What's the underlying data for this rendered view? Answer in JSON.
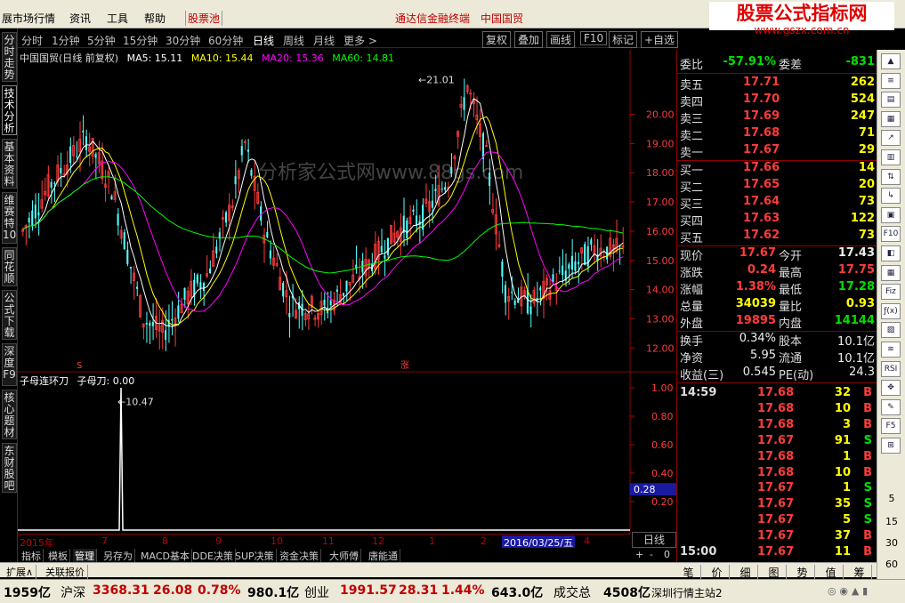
{
  "menu": {
    "items": [
      "展市场行情",
      "资讯",
      "工具",
      "帮助",
      "股票池"
    ],
    "center_link": "通达信金融终端",
    "stock_title": "中国国贸"
  },
  "logo": {
    "title": "股票公式指标网",
    "url": "www.gszx.com.cn"
  },
  "left_tabs": [
    "分时走势",
    "技术分析",
    "基本资料",
    "维赛特10",
    "同花顺",
    "公式下载",
    "深度F9",
    "核心题材",
    "东财股吧"
  ],
  "period_bar": {
    "periods": [
      "分时",
      "1分钟",
      "5分钟",
      "15分钟",
      "30分钟",
      "60分钟",
      "日线",
      "周线",
      "月线",
      "更多 >"
    ],
    "selected": "日线",
    "buttons": [
      "复权",
      "叠加",
      "画线",
      "F10",
      "标记",
      "+自选"
    ]
  },
  "ma_legend": {
    "title": "中国国贸(日线 前复权)",
    "ma5": "MA5: 15.11",
    "ma10": "MA10: 15.44",
    "ma20": "MA20: 15.36",
    "ma60": "MA60: 14.81"
  },
  "chart_data": {
    "type": "candlestick",
    "price_axis": {
      "ticks": [
        "20.00",
        "19.00",
        "18.00",
        "17.00",
        "16.00",
        "15.00",
        "14.00",
        "13.00",
        "12.00"
      ],
      "range": [
        11.4,
        21.6
      ]
    },
    "annotations": {
      "high": "21.01",
      "low": "10.47"
    },
    "markers": {
      "s": "S",
      "up": "涨"
    },
    "watermark": "分析家公式网www.88gs.com",
    "indicator": {
      "name": "子母连环刀",
      "label": "子母刀: 0.00",
      "ticks": [
        "1.00",
        "0.80",
        "0.60",
        "0.40",
        "0.20"
      ],
      "current": "0.28",
      "spike_value": 1.0
    },
    "months": [
      "2015年",
      "7",
      "8",
      "9",
      "10",
      "11",
      "12",
      "1",
      "2",
      "2016/03/25/五",
      "4"
    ]
  },
  "day_line": "日线",
  "zoom": [
    "+",
    "-",
    "0"
  ],
  "bottom_tabs": [
    "指标",
    "模板",
    "管理",
    "另存为",
    "MACD基本",
    "DDE决策",
    "SUP决策",
    "资金决策",
    "大师傅",
    "唐能通"
  ],
  "ext_tabs": [
    "扩展∧",
    "关联报价"
  ],
  "quote": {
    "weibi": {
      "label": "委比",
      "value": "-57.91%",
      "label2": "委差",
      "value2": "-831"
    },
    "sell": [
      {
        "label": "卖五",
        "price": "17.71",
        "vol": "262"
      },
      {
        "label": "卖四",
        "price": "17.70",
        "vol": "524"
      },
      {
        "label": "卖三",
        "price": "17.69",
        "vol": "247"
      },
      {
        "label": "卖二",
        "price": "17.68",
        "vol": "71"
      },
      {
        "label": "卖一",
        "price": "17.67",
        "vol": "29"
      }
    ],
    "buy": [
      {
        "label": "买一",
        "price": "17.66",
        "vol": "14"
      },
      {
        "label": "买二",
        "price": "17.65",
        "vol": "20"
      },
      {
        "label": "买三",
        "price": "17.64",
        "vol": "73"
      },
      {
        "label": "买四",
        "price": "17.63",
        "vol": "122"
      },
      {
        "label": "买五",
        "price": "17.62",
        "vol": "73"
      }
    ],
    "stats": [
      {
        "l1": "现价",
        "v1": "17.67",
        "c1": "red",
        "l2": "今开",
        "v2": "17.43",
        "c2": "white"
      },
      {
        "l1": "涨跌",
        "v1": "0.24",
        "c1": "red",
        "l2": "最高",
        "v2": "17.75",
        "c2": "red"
      },
      {
        "l1": "涨幅",
        "v1": "1.38%",
        "c1": "red",
        "l2": "最低",
        "v2": "17.28",
        "c2": "green"
      },
      {
        "l1": "总量",
        "v1": "34039",
        "c1": "yellow",
        "l2": "量比",
        "v2": "0.93",
        "c2": "yellow"
      },
      {
        "l1": "外盘",
        "v1": "19895",
        "c1": "red",
        "l2": "内盘",
        "v2": "14144",
        "c2": "green"
      }
    ],
    "stats2": [
      {
        "l1": "换手",
        "v1": "0.34%",
        "l2": "股本",
        "v2": "10.1亿"
      },
      {
        "l1": "净资",
        "v1": "5.95",
        "l2": "流通",
        "v2": "10.1亿"
      },
      {
        "l1": "收益(三)",
        "v1": "0.545",
        "l2": "PE(动)",
        "v2": "24.3"
      }
    ],
    "trades": [
      {
        "t": "14:59",
        "p": "17.68",
        "v": "32",
        "s": "B"
      },
      {
        "t": "",
        "p": "17.68",
        "v": "10",
        "s": "B"
      },
      {
        "t": "",
        "p": "17.68",
        "v": "3",
        "s": "B"
      },
      {
        "t": "",
        "p": "17.67",
        "v": "91",
        "s": "S"
      },
      {
        "t": "",
        "p": "17.68",
        "v": "1",
        "s": "B"
      },
      {
        "t": "",
        "p": "17.68",
        "v": "10",
        "s": "B"
      },
      {
        "t": "",
        "p": "17.67",
        "v": "1",
        "s": "S"
      },
      {
        "t": "",
        "p": "17.67",
        "v": "35",
        "s": "S"
      },
      {
        "t": "",
        "p": "17.67",
        "v": "5",
        "s": "S"
      },
      {
        "t": "",
        "p": "17.67",
        "v": "37",
        "s": "B"
      },
      {
        "t": "15:00",
        "p": "17.67",
        "v": "11",
        "s": "B"
      }
    ],
    "tabs": [
      "笔",
      "价",
      "细",
      "图",
      "势",
      "值",
      "筹"
    ]
  },
  "right_tool_numbers": [
    "5",
    "15",
    "30",
    "60"
  ],
  "status": {
    "amount1": "1959亿",
    "hs_label": "沪深",
    "hs_index": "3368.31",
    "hs_chg": "26.08",
    "hs_pct": "0.78%",
    "hs_amt": "980.1亿",
    "cy_label": "创业",
    "cy_index": "1991.57",
    "cy_chg": "28.31",
    "cy_pct": "1.44%",
    "cy_amt": "643.0亿",
    "total_label": "成交总",
    "total_val": "4508亿",
    "server": "深圳行情主站2"
  }
}
